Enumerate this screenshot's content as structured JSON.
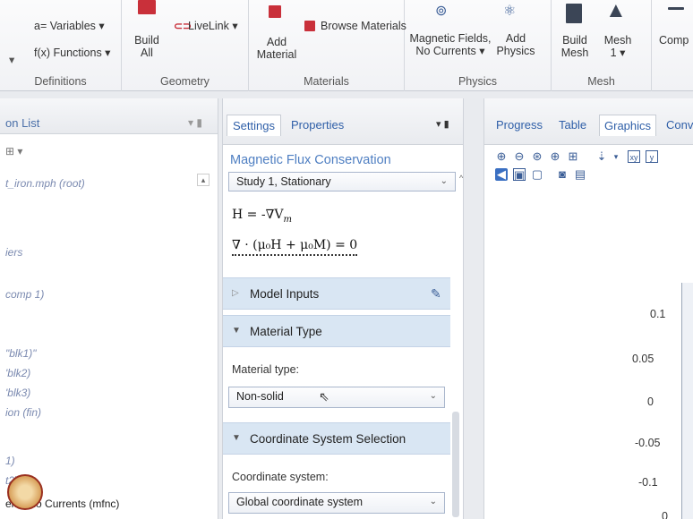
{
  "ribbon": {
    "definitions": {
      "variables": "a= Variables ▾",
      "functions": "f(x) Functions ▾",
      "group": "Definitions"
    },
    "geometry": {
      "build_all": "Build All",
      "livelink": "LiveLink ▾",
      "group": "Geometry"
    },
    "materials": {
      "add_material": "Add Material",
      "browse": "Browse Materials",
      "group": "Materials"
    },
    "physics": {
      "magnetic_fields": "Magnetic Fields, No Currents ▾",
      "add_physics": "Add Physics",
      "group": "Physics"
    },
    "mesh": {
      "build_mesh": "Build Mesh",
      "mesh1": "Mesh 1 ▾",
      "group": "Mesh"
    },
    "study": {
      "compute": "Comp"
    }
  },
  "left_panel": {
    "title": "on List",
    "items": [
      "t_iron.mph (root)",
      "iers",
      "comp 1)",
      "\"blk1)\"",
      "'blk2)",
      "'blk3)",
      "ion (fin)",
      "1)",
      "t2)",
      "elds No Currents (mfnc)"
    ]
  },
  "settings": {
    "tab_settings": "Settings",
    "tab_properties": "Properties",
    "title": "Magnetic Flux Conservation",
    "study_select": "Study 1, Stationary",
    "eq1": "H = -∇V",
    "eq1_sub": "m",
    "eq2": "∇ · (μ₀H + μ₀M) = 0",
    "model_inputs": "Model Inputs",
    "material_type_section": "Material Type",
    "material_type_label": "Material type:",
    "material_type_value": "Non-solid",
    "coord_section": "Coordinate System Selection",
    "coord_label": "Coordinate system:",
    "coord_value": "Global coordinate system"
  },
  "graphics": {
    "tabs": [
      "Progress",
      "Table",
      "Graphics",
      "Conv"
    ],
    "axis_ticks": [
      "0.1",
      "0.05",
      "0",
      "-0.05",
      "-0.1",
      "0"
    ]
  }
}
